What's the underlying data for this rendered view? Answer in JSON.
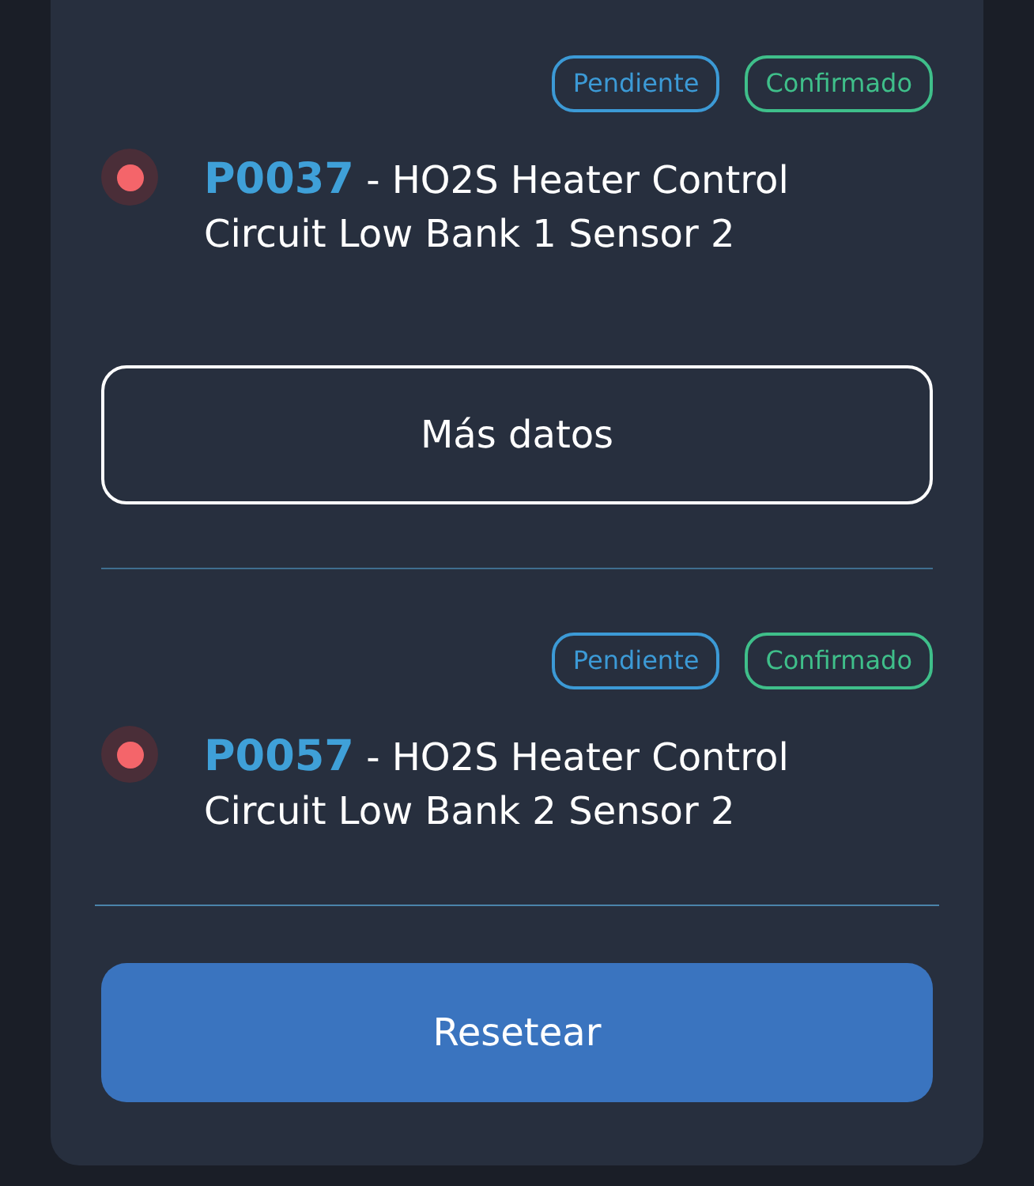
{
  "faults": [
    {
      "statuses": [
        {
          "label": "Pendiente",
          "kind": "pending"
        },
        {
          "label": "Confirmado",
          "kind": "confirmed"
        }
      ],
      "color": "#f4656a",
      "code": "P0037",
      "description": "- HO2S Heater Control Circuit Low Bank 1 Sensor 2",
      "more_button": "Más datos"
    },
    {
      "statuses": [
        {
          "label": "Pendiente",
          "kind": "pending"
        },
        {
          "label": "Confirmado",
          "kind": "confirmed"
        }
      ],
      "color": "#f4656a",
      "code": "P0057",
      "description": "- HO2S Heater Control Circuit Low Bank 2 Sensor 2"
    }
  ],
  "reset_button": "Resetear"
}
